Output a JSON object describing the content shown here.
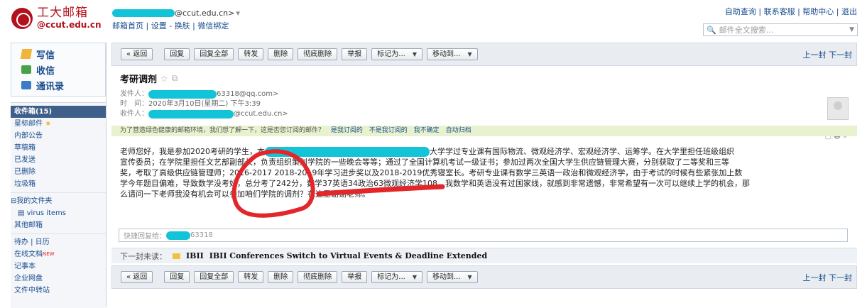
{
  "brand": {
    "name_cn": "工大邮箱",
    "domain": "@ccut.edu.cn"
  },
  "account": {
    "email_suffix": "@ccut.edu.cn>",
    "dropdown": "▾",
    "links": "邮箱首页 | 设置 - 换肤 | 微信绑定"
  },
  "top_links": "自助查询 | 联系客服 | 帮助中心 | 退出",
  "search": {
    "placeholder": "邮件全文搜索..."
  },
  "quick": {
    "compose": "写信",
    "inbox": "收信",
    "contacts": "通讯录"
  },
  "folders": {
    "inbox": "收件箱(15)",
    "starred": "星标邮件",
    "notice": "内部公告",
    "drafts": "草稿箱",
    "sent": "已发送",
    "deleted": "已删除",
    "junk": "垃圾箱",
    "my_folders": "我的文件夹",
    "virus": "virus items",
    "other": "其他邮箱",
    "todo": "待办 | 日历",
    "online_docs": "在线文档",
    "new_badge": "NEW",
    "notes": "记事本",
    "netdisk": "企业网盘",
    "transfer": "文件中转站"
  },
  "toolbar": {
    "back": "« 返回",
    "reply": "回复",
    "reply_all": "回复全部",
    "forward": "转发",
    "delete": "删除",
    "perm_delete": "彻底删除",
    "report": "举报",
    "mark_as": "标记为...",
    "move_to": "移动到...",
    "prev_next": "上一封 下一封"
  },
  "mail": {
    "subject": "考研调剂",
    "from_label": "发件人：",
    "from_value": "63318@qq.com>",
    "time_label": "时　间：",
    "time_value": "2020年3月10日(星期二) 下午3:39",
    "to_label": "收件人：",
    "to_value": "@ccut.edu.cn>"
  },
  "notice": {
    "text": "为了营造绿色健康的邮箱环境，我们想了解一下，这是否您订阅的邮件？",
    "opt1": "是我订阅的",
    "opt2": "不是我订阅的",
    "opt3": "我不确定",
    "opt4": "自动归档"
  },
  "body": {
    "l1a": "老师您好，我是参加2020考研的学生，本",
    "l1b": "大学学过专业课有国际物流、微观经济学、宏观经济学、运筹学。在大学里担任班级组织",
    "l2": "宣传委员；在学院里担任文艺部副部长，负责组织策划学院的一些晚会等等；通过了全国计算机考试一级证书；参加过两次全国大学生供应链管理大赛，分别获取了二等奖和三等",
    "l3": "奖，考取了高级供应链管理师；2016-2017 2018-2019年学习进步奖以及2018-2019优秀寝室长。考研专业课有数学三英语一政治和微观经济学，由于考试的时候有些紧张加上数",
    "l4": "学今年题目偏难，导致数学没考好，总分考了242分，数学37英语34政治63微观经济学108，我数学和英语没有过国家线，就感到非常遗憾，非常希望有一次可以继续上学的机会，那",
    "l5": "么请问一下老师我没有机会可以参加咱们学院的调剂？在这里谢谢老师。"
  },
  "reply_box": {
    "label": "快捷回复给：",
    "value": "63318"
  },
  "next_mail": {
    "label": "下一封未读：",
    "from": "IBII",
    "subject": "IBII Conferences Switch to Virtual Events & Deadline Extended"
  },
  "colors": {
    "brand_red": "#b3121d",
    "link_blue": "#1a4d8f",
    "redaction": "#13c3d7",
    "annotation_red": "#e2262a",
    "notice_bg": "#e8f2cf"
  }
}
